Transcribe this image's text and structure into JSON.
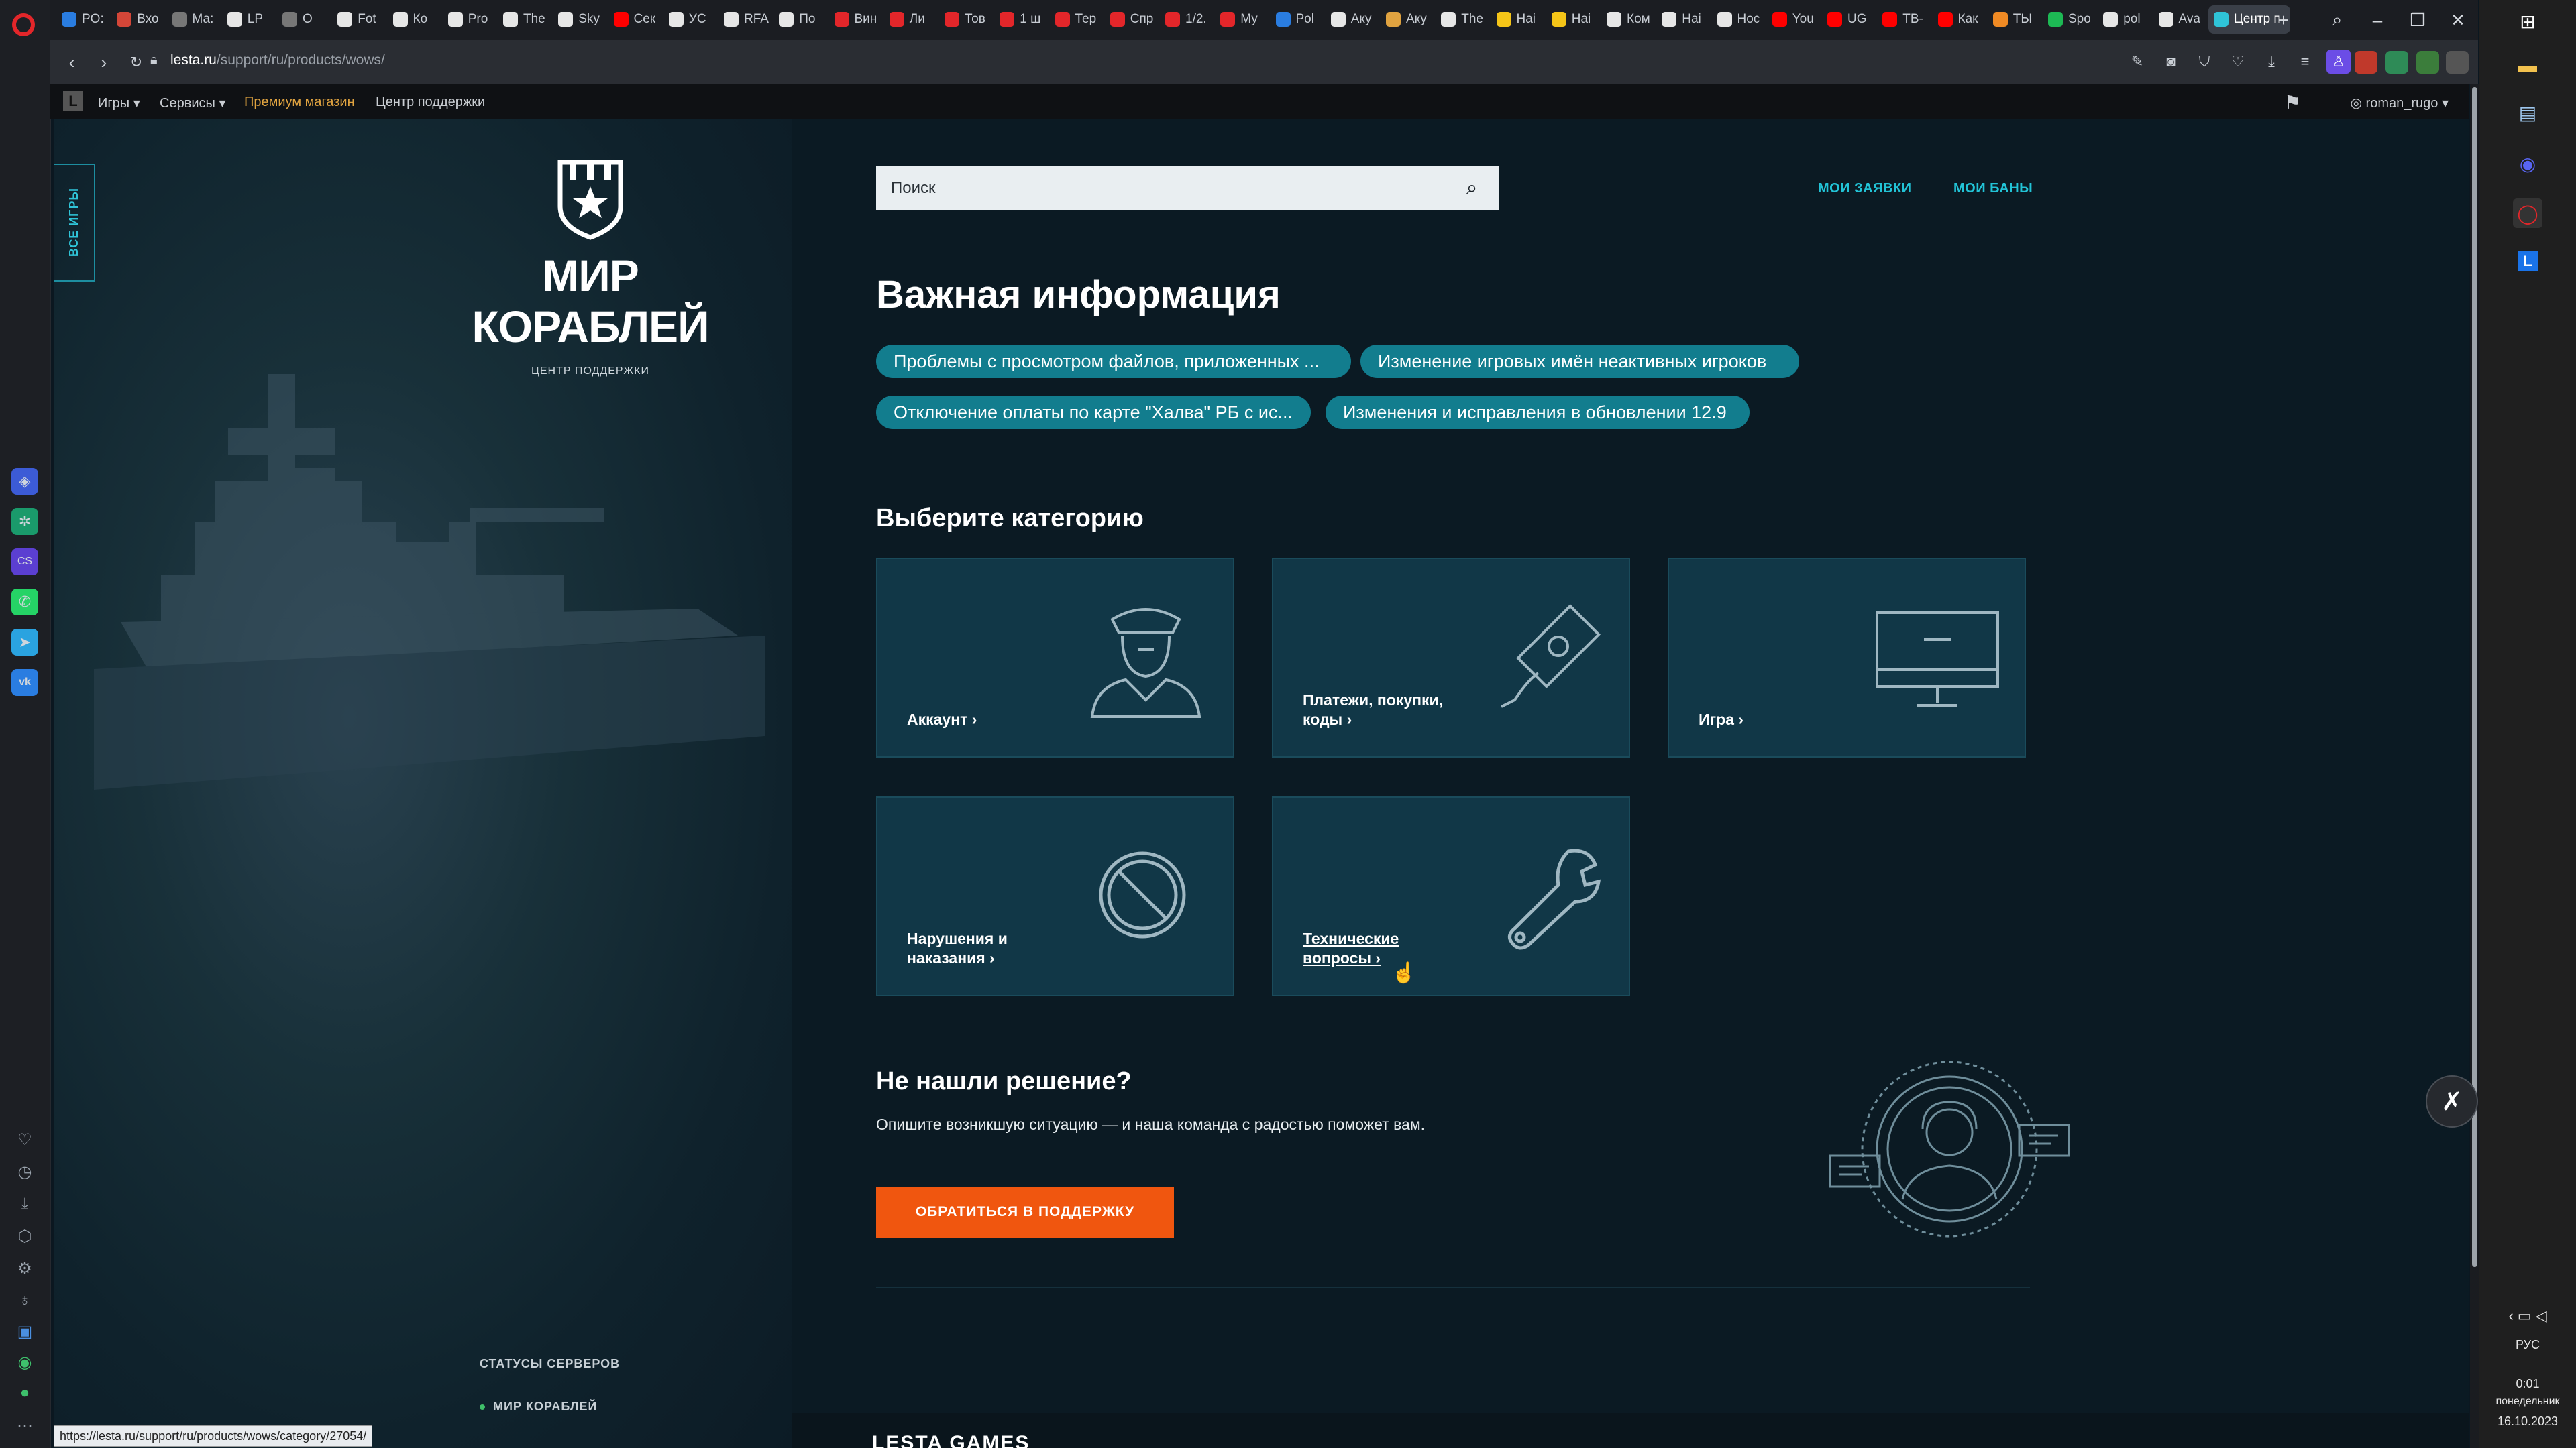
{
  "browser": {
    "tabs": [
      {
        "label": "PO:",
        "color": "#2a7de1"
      },
      {
        "label": "Вхо",
        "color": "#d44638"
      },
      {
        "label": "Ма:",
        "color": "#777777"
      },
      {
        "label": "LP",
        "color": "#e6e6e6"
      },
      {
        "label": "O",
        "color": "#777777"
      },
      {
        "label": "Fot",
        "color": "#e6e6e6"
      },
      {
        "label": "Ко",
        "color": "#e6e6e6"
      },
      {
        "label": "Pro",
        "color": "#e6e6e6"
      },
      {
        "label": "The",
        "color": "#e6e6e6"
      },
      {
        "label": "Sky",
        "color": "#e6e6e6"
      },
      {
        "label": "Сек",
        "color": "#ff0000"
      },
      {
        "label": "УС",
        "color": "#e6e6e6"
      },
      {
        "label": "RFA",
        "color": "#e6e6e6"
      },
      {
        "label": "По",
        "color": "#e6e6e6"
      },
      {
        "label": "Вин",
        "color": "#e3262a"
      },
      {
        "label": "Ли",
        "color": "#e3262a"
      },
      {
        "label": "Тов",
        "color": "#e3262a"
      },
      {
        "label": "1 ш",
        "color": "#e3262a"
      },
      {
        "label": "Тер",
        "color": "#e3262a"
      },
      {
        "label": "Спр",
        "color": "#e3262a"
      },
      {
        "label": "1/2.",
        "color": "#e3262a"
      },
      {
        "label": "Му",
        "color": "#e3262a"
      },
      {
        "label": "Pol",
        "color": "#2a7de1"
      },
      {
        "label": "Аку",
        "color": "#e6e6e6"
      },
      {
        "label": "Аку",
        "color": "#e0a340"
      },
      {
        "label": "The",
        "color": "#e6e6e6"
      },
      {
        "label": "Наі",
        "color": "#f5c518"
      },
      {
        "label": "Наі",
        "color": "#f5c518"
      },
      {
        "label": "Ком",
        "color": "#e6e6e6"
      },
      {
        "label": "Наі",
        "color": "#e6e6e6"
      },
      {
        "label": "Нос",
        "color": "#e6e6e6"
      },
      {
        "label": "You",
        "color": "#ff0000"
      },
      {
        "label": "UG",
        "color": "#ff0000"
      },
      {
        "label": "ТВ-",
        "color": "#ff0000"
      },
      {
        "label": "Как",
        "color": "#ff0000"
      },
      {
        "label": "ТЫ",
        "color": "#f08a24"
      },
      {
        "label": "Spo",
        "color": "#1db954"
      },
      {
        "label": "pol",
        "color": "#e6e6e6"
      },
      {
        "label": "Ava",
        "color": "#e6e6e6"
      },
      {
        "label": "Центр п",
        "color": "#2fc4d8"
      }
    ],
    "url_domain": "lesta.ru",
    "url_path": "/support/ru/products/wows/",
    "status_url": "https://lesta.ru/support/ru/products/wows/category/27054/"
  },
  "site_nav": {
    "games": "Игры",
    "services": "Сервисы",
    "premium": "Премиум магазин",
    "support": "Центр поддержки",
    "username": "roman_rugo"
  },
  "left": {
    "all_games": "ВСЕ ИГРЫ",
    "brand_title": "МИР КОРАБЛЕЙ",
    "brand_sub": "ЦЕНТР ПОДДЕРЖКИ",
    "server_status": "СТАТУСЫ СЕРВЕРОВ",
    "server_item": "МИР КОРАБЛЕЙ"
  },
  "main": {
    "search_placeholder": "Поиск",
    "my_requests": "МОИ ЗАЯВКИ",
    "my_bans": "МОИ БАНЫ",
    "important_title": "Важная информация",
    "chips": [
      "Проблемы с просмотром файлов, приложенных ...",
      "Изменение игровых имён неактивных игроков",
      "Отключение оплаты по карте \"Халва\" РБ с ис...",
      "Изменения и исправления в обновлении 12.9"
    ],
    "category_title": "Выберите категорию",
    "categories": [
      {
        "line1": "Аккаунт ›",
        "line2": ""
      },
      {
        "line1": "Платежи, покупки,",
        "line2": "коды ›"
      },
      {
        "line1": "Игра ›",
        "line2": ""
      },
      {
        "line1": "Нарушения и",
        "line2": "наказания ›"
      },
      {
        "line1": "Технические",
        "line2": "вопросы ›"
      }
    ],
    "not_found_title": "Не нашли решение?",
    "not_found_text": "Опишите возникшую ситуацию — и наша команда с радостью поможет вам.",
    "cta": "ОБРАТИТЬСЯ В ПОДДЕРЖКУ",
    "footer_partial": "LESTA GAMES"
  },
  "taskbar": {
    "lang": "РУС",
    "time": "0:01",
    "day": "понедельник",
    "date": "16.10.2023"
  },
  "colors": {
    "accent": "#22c3d6",
    "chip": "#127d8e",
    "card": "#113747",
    "cta": "#f0560f",
    "premium": "#e0a340"
  }
}
